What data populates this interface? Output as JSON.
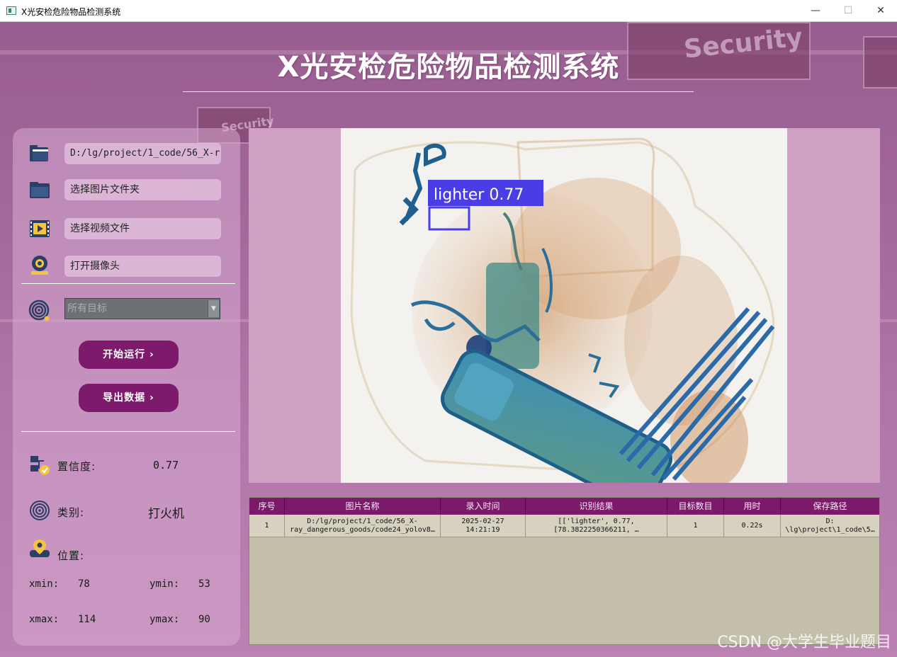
{
  "window": {
    "title": "X光安检危险物品检测系统",
    "controls": {
      "minimize": "—",
      "maximize": "☐",
      "close": "✕"
    }
  },
  "header": {
    "title": "X光安检危险物品检测系统"
  },
  "background": {
    "sign_text": "Security",
    "sign_text_small": "Security"
  },
  "sidebar": {
    "path_field": "D:/lg/project/1_code/56_X-r",
    "select_folder": "选择图片文件夹",
    "select_video": "选择视频文件",
    "open_camera": "打开摄像头",
    "target_select": {
      "value": "所有目标"
    },
    "start_button": "开始运行 ›",
    "export_button": "导出数据 ›"
  },
  "info": {
    "confidence_label": "置信度:",
    "confidence_value": "0.77",
    "class_label": "类别:",
    "class_value": "打火机",
    "position_label": "位置:",
    "xmin_label": "xmin:",
    "xmin_value": "78",
    "ymin_label": "ymin:",
    "ymin_value": "53",
    "xmax_label": "xmax:",
    "xmax_value": "114",
    "ymax_label": "ymax:",
    "ymax_value": "90"
  },
  "detection": {
    "label": "lighter 0.77",
    "box_color": "#4a3de6"
  },
  "table": {
    "headers": [
      "序号",
      "图片名称",
      "录入时间",
      "识别结果",
      "目标数目",
      "用时",
      "保存路径"
    ],
    "rows": [
      {
        "index": "1",
        "name": "D:/lg/project/1_code/56_X-\nray_dangerous_goods/code24_yolov8…",
        "time": "2025-02-27\n14:21:19",
        "result": "[['lighter', 0.77,\n[78.3822250366211, …",
        "count": "1",
        "duration": "0.22s",
        "path": "D:\n\\lg\\project\\1_code\\5…"
      }
    ]
  },
  "watermark": "CSDN @大学生毕业题目",
  "colors": {
    "accent": "#7d1a6b",
    "panel": "#d7aad2",
    "table_bg": "#c4bfab"
  }
}
